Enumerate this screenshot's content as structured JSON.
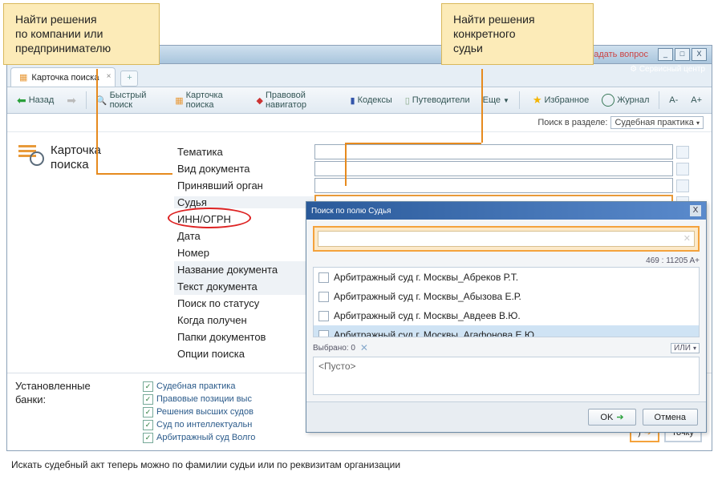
{
  "callouts": {
    "left": "Найти решения\nпо компании или\nпредпринимателю",
    "right": "Найти решения\nконкретного\nсудьи"
  },
  "window": {
    "ask": "Задать вопрос",
    "service": "Сервисный центр",
    "btns": [
      "_",
      "□",
      "X"
    ]
  },
  "tabs": {
    "main": "Карточка поиска"
  },
  "toolbar": {
    "back": "Назад",
    "quick": "Быстрый поиск",
    "card": "Карточка поиска",
    "nav": "Правовой навигатор",
    "codex": "Кодексы",
    "guide": "Путеводители",
    "more": "Еще",
    "fav": "Избранное",
    "journal": "Журнал",
    "aminus": "A-",
    "aplus": "A+"
  },
  "subbar": {
    "label": "Поиск в разделе:",
    "value": "Судебная практика"
  },
  "page": {
    "title1": "Карточка",
    "title2": "поиска"
  },
  "fields": {
    "tematika": "Тематика",
    "vid": "Вид документа",
    "organ": "Принявший орган",
    "sudya": "Судья",
    "inn": "ИНН/ОГРН",
    "data": "Дата",
    "nomer": "Номер",
    "nazv": "Название документа",
    "text": "Текст документа",
    "status": "Поиск по статусу",
    "kogda": "Когда получен",
    "papki": "Папки документов",
    "opcii": "Опции поиска"
  },
  "banks": {
    "label": "Установленные\nбанки:",
    "items": [
      "Судебная практика",
      "Правовые позиции выс",
      "Решения высших судов",
      "Суд по интеллектуальн",
      "Арбитражный суд Волго"
    ]
  },
  "dialog": {
    "title": "Поиск по полю Судья",
    "meta": "469 : 11205   A+",
    "items": [
      "Арбитражный суд г. Москвы_Абреков Р.Т.",
      "Арбитражный суд г. Москвы_Абызова Е.Р.",
      "Арбитражный суд г. Москвы_Авдеев В.Ю.",
      "Арбитражный суд г. Москвы_Агафонова Е.Ю."
    ],
    "selected": "Выбрано: 0",
    "ili": "ИЛИ",
    "empty": "<Пусто>",
    "ok": "OK",
    "cancel": "Отмена"
  },
  "bottom_btns": {
    "b1": ")",
    "b2": "точку"
  },
  "caption": "Искать судебный акт теперь можно по фамилии судьи или по реквизитам организации"
}
